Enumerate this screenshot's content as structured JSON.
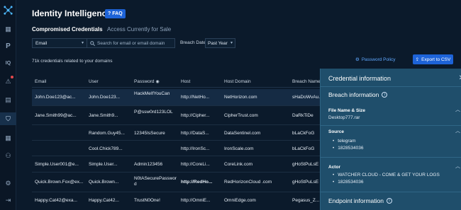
{
  "app": {
    "title": "Identity Intelligence",
    "faq_label": "FAQ"
  },
  "nav_rail": {
    "items": [
      {
        "name": "dashboard-icon",
        "glyph": "▦"
      },
      {
        "name": "p-icon",
        "glyph": "P"
      },
      {
        "name": "iq-icon",
        "glyph": "IQ"
      },
      {
        "name": "alert-icon",
        "glyph": "⚠"
      },
      {
        "name": "chart-icon",
        "glyph": "▤"
      },
      {
        "name": "shield-icon",
        "glyph": "⛉"
      },
      {
        "name": "grid-icon",
        "glyph": "▦"
      },
      {
        "name": "user-group-icon",
        "glyph": "⚇"
      },
      {
        "name": "settings-icon",
        "glyph": "⚙"
      },
      {
        "name": "logout-icon",
        "glyph": "⇥"
      }
    ]
  },
  "tabs": {
    "active": "Compromised Credentials",
    "inactive": "Access Currently for Sale"
  },
  "filters": {
    "field_value": "Email",
    "search_placeholder": "Search for email or email domain",
    "breach_date_label": "Breach Date:",
    "breach_date_value": "Past Year"
  },
  "summary": {
    "count_text": "71k  credentials related to your domains",
    "password_policy": "Password Policy",
    "export_label": "Export to CSV"
  },
  "table": {
    "columns": [
      "Email",
      "User",
      "Password",
      "Host",
      "Host Domain",
      "Breach Name"
    ],
    "rows": [
      {
        "email": "John.Doe123@ac...",
        "user": "John.Doe123...",
        "password": "HackMeIfYouCan",
        "host": "http://NetHo...",
        "domain": "NetHorizon.com",
        "breach": "sHaDoWvAu..."
      },
      {
        "email": "Jane.Smith99@ac...",
        "user": "Jane.Smith9...",
        "password": "P@ssw0rd123LOL",
        "host": "http://Cipher...",
        "domain": "CipherTrust.com",
        "breach": "DaRkTiDe"
      },
      {
        "email": "",
        "user": "Random.Guy45...",
        "password": "12345IsSecure",
        "host": "http://DataS...",
        "domain": "DataSentinel.com",
        "breach": "bLaCkFoG"
      },
      {
        "email": "",
        "user": "Cool.Chick789...",
        "password": "",
        "host": "http://IronSc...",
        "domain": "IronScale.com",
        "breach": "bLaCkFoG"
      },
      {
        "email": "Simple.User001@e...",
        "user": "Simple.User...",
        "password": "Admin123456",
        "host": "http://CoreLi...",
        "domain": "CoreLink.com",
        "breach": "gHoStPuLsE"
      },
      {
        "email": "Quick.Brown.Fox@ex...",
        "user": "Quick.Brown...",
        "password": "N0tASecurePassword",
        "host": "http://RedHo...",
        "domain": "RedHorizonCloud .com",
        "breach": "gHoStPuLsE"
      },
      {
        "email": "Happy.Cat42@exa...",
        "user": "Happy.Cat42...",
        "password": "TrustN0One!",
        "host": "http://OmniE...",
        "domain": "OmniEdge.com",
        "breach": "Pegasus_Z..."
      }
    ]
  },
  "panel": {
    "title": "Credential information",
    "breach_heading": "Breach information",
    "file_label": "File Name & Size",
    "file_value": "Desktop777.rar",
    "source_label": "Source",
    "source_items": [
      "telegram",
      "1828534036"
    ],
    "actor_label": "Actor",
    "actor_items": [
      "WATCHER CLOUD - COME & GET YOUR LOGS",
      "1828534036"
    ],
    "endpoint_heading": "Endpoint information"
  },
  "colors": {
    "background": "#0b1a2b",
    "accent": "#1d63d8",
    "panel": "#1f4e6b",
    "link": "#5fa8ff"
  }
}
